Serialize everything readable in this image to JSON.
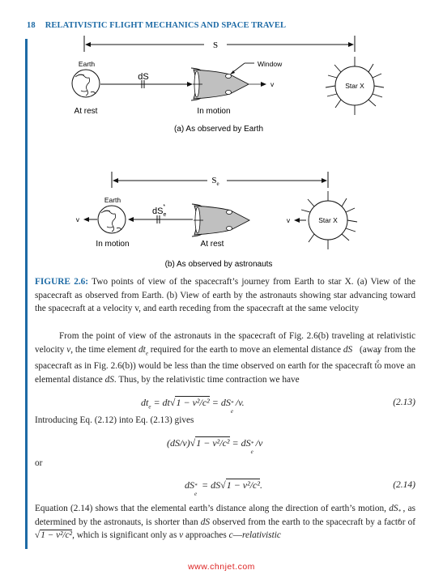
{
  "header": {
    "page_number": "18",
    "running_title": "RELATIVISTIC FLIGHT MECHANICS AND SPACE TRAVEL"
  },
  "colors": {
    "accent": "#1d6aa5",
    "watermark": "#dd2222",
    "spacecraft_fill": "#c0c0c0"
  },
  "figure": {
    "panel_a": {
      "distance_label": "S",
      "earth_label": "Earth",
      "element_label": "dS",
      "window_label": "Window",
      "velocity_label": "v",
      "star_label": "Star X",
      "earth_state": "At rest",
      "craft_state": "In motion",
      "subcaption": "(a) As observed by Earth"
    },
    "panel_b": {
      "distance_label": "S",
      "distance_sub": "e",
      "earth_label": "Earth",
      "element_label": "dS",
      "element_sub": "e",
      "element_sup": "*",
      "earth_velocity_label": "v",
      "star_velocity_label": "v",
      "star_label": "Star X",
      "earth_state": "In motion",
      "craft_state": "At rest",
      "subcaption": "(b) As observed by astronauts"
    },
    "caption_label": "FIGURE 2.6:",
    "caption_text": " Two points of view of the spacecraft’s journey from Earth to star X. (a) View of the spacecraft as observed from Earth. (b) View of earth by the astronauts showing star advancing toward the spacecraft at a velocity v, and earth receding from the spacecraft at the same velocity"
  },
  "body": {
    "para1": {
      "t1": "From the point of view of the astronauts in the spacecraft of Fig. 2.6(b) traveling at relativistic velocity ",
      "v": "v",
      "t2": ", the time element ",
      "dte": "dt",
      "dte_sub": "e",
      "t3": " required for the earth to move an elemental distance ",
      "dse": "dS",
      "t4": " (away from the spacecraft as in Fig. 2.6(b)) would be less than the time observed on earth for the spacecraft to move an elemental distance ",
      "ds": "dS",
      "t5": ". Thus, by the relativistic time contraction we have"
    },
    "eq213": {
      "lhs": "dt",
      "lhs_sub": "e",
      "mid": " = dt",
      "sqrt": "1 − v²/c²",
      "rhs": " = dS",
      "rhs_tail": "/v.",
      "number": "(2.13)"
    },
    "intro_line": "Introducing Eq. (2.12) into Eq. (2.13) gives",
    "eq_mid": {
      "lhs": "(dS/v)",
      "sqrt": "1 − v²/c²",
      "rhs": " = dS",
      "rhs_tail": "/v"
    },
    "or_line": "or",
    "eq214": {
      "lhs": "dS",
      "mid": " = dS",
      "sqrt": "1 − v²/c²",
      "tail": ".",
      "number": "(2.14)"
    },
    "para2": {
      "t1": "Equation (2.14) shows that the elemental earth’s distance along the direction of earth’s motion, ",
      "dse": "dS",
      "t2": ", as determined by the astronauts, is shorter than ",
      "ds": "dS",
      "t3": " observed from the earth to the spacecraft by a factor of ",
      "sqrt": "1 − v²/c²",
      "t4": ", which is significant only as ",
      "v": "v",
      "t5": " approaches ",
      "c": "c",
      "t6": "—",
      "rel": "relativistic"
    }
  },
  "watermark": "www.chnjet.com"
}
